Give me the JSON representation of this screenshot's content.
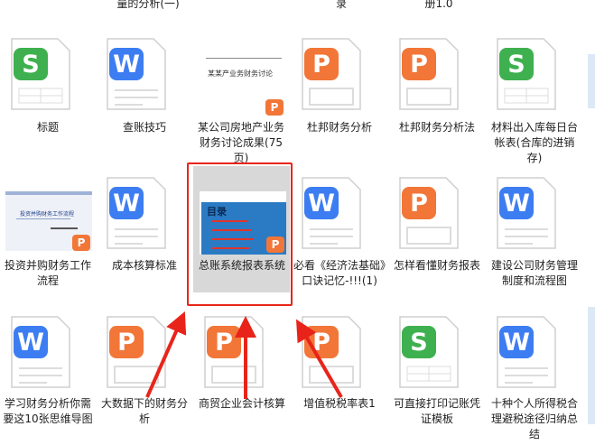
{
  "top_row_labels": [
    "量的分析(一)",
    "录",
    "册1.0"
  ],
  "row1": [
    {
      "name": "标题",
      "type": "S"
    },
    {
      "name": "查账技巧",
      "type": "W"
    },
    {
      "name": "某公司房地产业务财务讨论成果(75页)",
      "type": "P",
      "thumb_text": "某某产业务财务讨论"
    },
    {
      "name": "杜邦财务分析",
      "type": "P"
    },
    {
      "name": "杜邦财务分析法",
      "type": "P"
    },
    {
      "name": "材料出入库每日台帐表(合库的进销存)",
      "type": "S"
    }
  ],
  "row2": [
    {
      "name": "投资并购财务工作流程",
      "type": "P",
      "thumb_text": "投资并购财务工作流程"
    },
    {
      "name": "成本核算标准",
      "type": "W"
    },
    {
      "name": "总账系统报表系统",
      "type": "P",
      "thumb_title": "目录",
      "selected": true
    },
    {
      "name": "必看《经济法基础》口诀记忆-!!!(1)",
      "type": "W"
    },
    {
      "name": "怎样看懂财务报表",
      "type": "P"
    },
    {
      "name": "建设公司财务管理制度和流程图",
      "type": "W"
    }
  ],
  "row3": [
    {
      "name": "学习财务分析你需要这10张思维导图",
      "type": "W"
    },
    {
      "name": "大数据下的财务分析",
      "type": "P"
    },
    {
      "name": "商贸企业会计核算",
      "type": "P"
    },
    {
      "name": "增值税税率表1",
      "type": "P"
    },
    {
      "name": "可直接打印记账凭证模板",
      "type": "S"
    },
    {
      "name": "十种个人所得税合理避税途径归纳总结",
      "type": "W"
    }
  ],
  "colors": {
    "S": "#3fb04f",
    "W": "#3d7df2",
    "P": "#f27638",
    "selection_border": "#e8241a",
    "arrow": "#e8241a"
  }
}
